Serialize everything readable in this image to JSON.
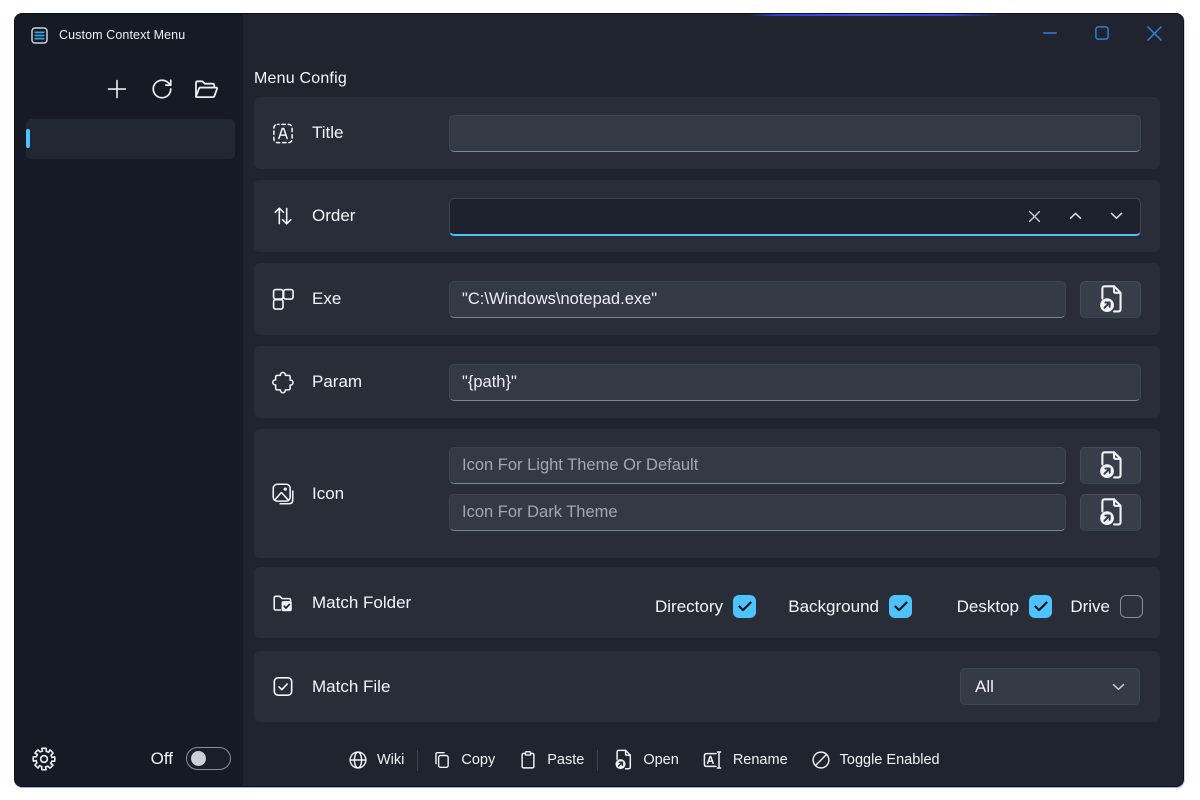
{
  "colors": {
    "accent": "#4cc2ff",
    "caption_glyph": "#2e80d8",
    "window_bg": "#20242e",
    "sidebar_bg": "#161a24",
    "card_bg": "#282d38",
    "input_bg": "#333945",
    "top_accent_line": "#3b4bdc"
  },
  "titlebar": {
    "title": "Custom Context Menu",
    "minimize": "minimize",
    "maximize": "maximize",
    "close": "close"
  },
  "sidebar": {
    "toolbar": {
      "add": "add",
      "refresh": "refresh",
      "open_folder": "open-folder"
    },
    "selected_item_label": "",
    "footer": {
      "settings": "settings",
      "toggle_label": "Off",
      "toggle_state": "off"
    }
  },
  "main": {
    "page_title": "Menu Config",
    "rows": {
      "title": {
        "label": "Title",
        "value": "",
        "placeholder": ""
      },
      "order": {
        "label": "Order",
        "value": "",
        "clear": "clear",
        "increase": "increase",
        "decrease": "decrease"
      },
      "exe": {
        "label": "Exe",
        "value": "\"C:\\Windows\\notepad.exe\"",
        "browse": "browse"
      },
      "param": {
        "label": "Param",
        "value": "\"{path}\""
      },
      "icon": {
        "label": "Icon",
        "light_placeholder": "Icon For Light Theme Or Default",
        "dark_placeholder": "Icon For Dark Theme",
        "light_value": "",
        "dark_value": ""
      },
      "match_folder": {
        "label": "Match Folder",
        "options": [
          {
            "label": "Directory",
            "checked": true
          },
          {
            "label": "Background",
            "checked": true
          },
          {
            "label": "Desktop",
            "checked": true
          },
          {
            "label": "Drive",
            "checked": false
          }
        ]
      },
      "match_file": {
        "label": "Match File",
        "value": "All"
      }
    },
    "commandbar": {
      "wiki": "Wiki",
      "copy": "Copy",
      "paste": "Paste",
      "open": "Open",
      "rename": "Rename",
      "toggle_enabled": "Toggle Enabled"
    }
  }
}
